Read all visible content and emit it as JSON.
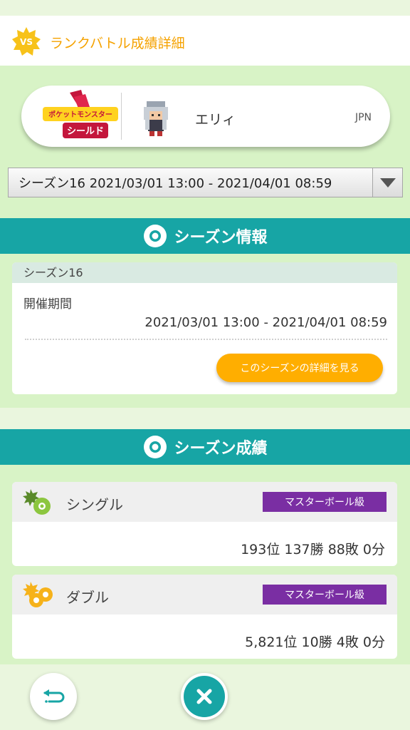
{
  "header": {
    "title": "ランクバトル成績詳細",
    "badge": "VS"
  },
  "trainer": {
    "game_logo_line1": "ポケットモンスター",
    "game_logo_line2": "シールド",
    "name": "エリィ",
    "region": "JPN"
  },
  "season_select": {
    "selected": "シーズン16 2021/03/01 13:00 - 2021/04/01 08:59"
  },
  "season_info": {
    "section_title": "シーズン情報",
    "season_name": "シーズン16",
    "period_label": "開催期間",
    "period_value": "2021/03/01 13:00 - 2021/04/01 08:59",
    "details_button": "このシーズンの詳細を見る"
  },
  "season_results": {
    "section_title": "シーズン成績",
    "modes": [
      {
        "name": "シングル",
        "rank": "マスターボール級",
        "record": "193位 137勝 88敗 0分"
      },
      {
        "name": "ダブル",
        "rank": "マスターボール級",
        "record": "5,821位 10勝 4敗 0分"
      }
    ]
  },
  "colors": {
    "accent_orange": "#ffae00",
    "teal": "#17a5a5",
    "rank_purple": "#7a2ea3",
    "page_green": "#d8f3c6"
  },
  "icons": {
    "back": "return-arrow-icon",
    "close": "close-x-icon",
    "single": "single-battle-icon",
    "double": "double-battle-icon"
  }
}
